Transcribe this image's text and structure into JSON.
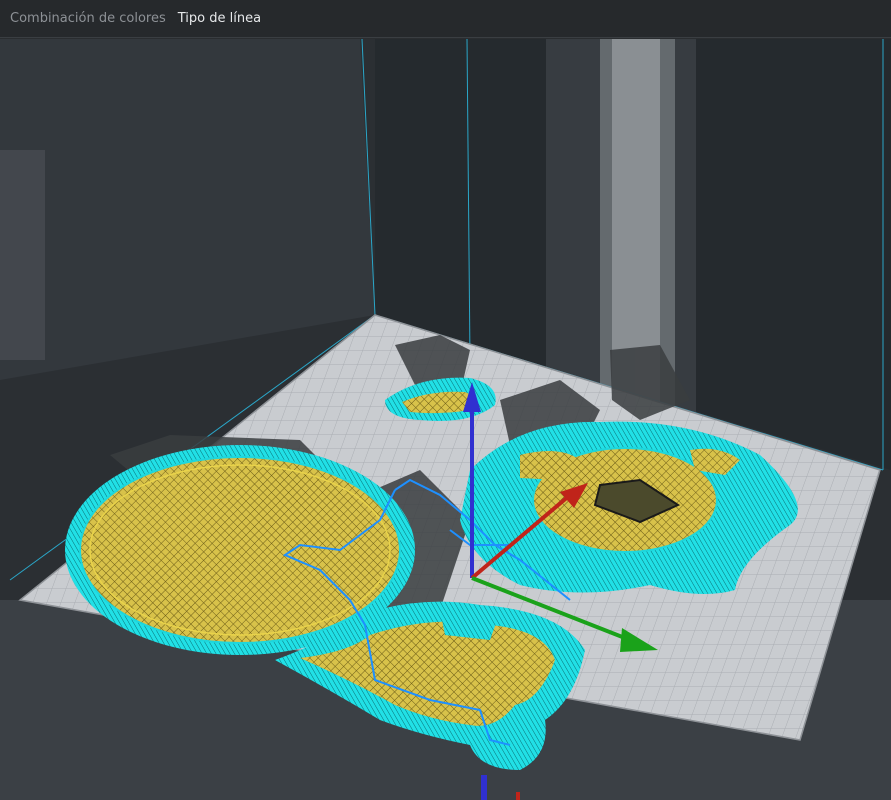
{
  "header": {
    "tabs": [
      {
        "label": "Combinación de colores",
        "active": false
      },
      {
        "label": "Tipo de línea",
        "active": true
      }
    ]
  },
  "colors": {
    "background": "#2a2d30",
    "build_plate": "#c9ccd0",
    "plate_grid": "#a9adb2",
    "outer_wall": "#21e0e6",
    "infill": "#d8c24a",
    "travel": "#1e90ff",
    "axis_x": "#c0241a",
    "axis_y": "#1aa21a",
    "axis_z": "#3030d0",
    "volume_edge": "#2aa6c8"
  },
  "icons": [
    "axis-x-arrow-icon",
    "axis-y-arrow-icon",
    "axis-z-arrow-icon"
  ]
}
